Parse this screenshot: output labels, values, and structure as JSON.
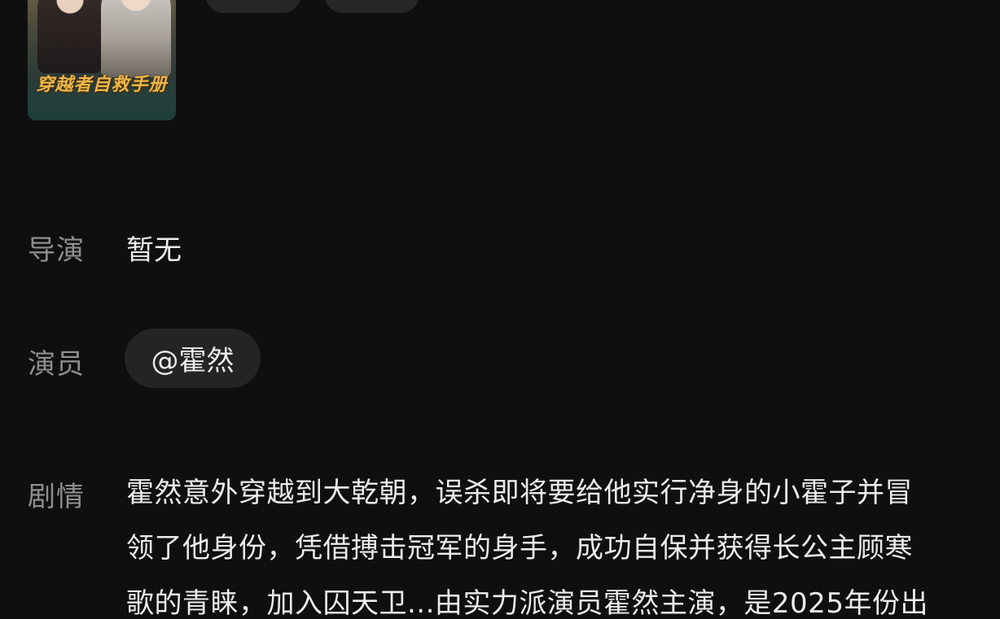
{
  "poster": {
    "title": "穿越者自救手册"
  },
  "details": {
    "director_label": "导演",
    "director_value": "暂无",
    "cast_label": "演员",
    "cast_chip": "@霍然",
    "plot_label": "剧情",
    "plot_lines": [
      "霍然意外穿越到大乾朝，误杀即将要给他实行净身的小霍子并冒",
      "领了他身份，凭借搏击冠军的身手，成功自保并获得长公主顾寒",
      "歌的青睐，加入囚天卫...由实力派演员霍然主演，是2025年份出"
    ]
  }
}
